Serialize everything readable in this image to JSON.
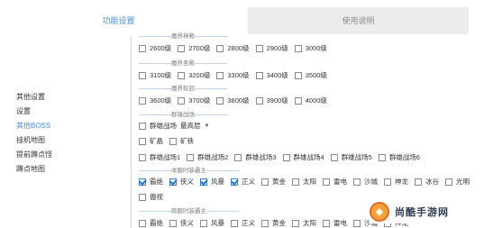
{
  "tabs": {
    "active": "功能设置",
    "inactive": "使用说明"
  },
  "sidebar": {
    "items": [
      {
        "label": "其他设置"
      },
      {
        "label": "设置"
      },
      {
        "label": "其他BOSS"
      },
      {
        "label": "挂机地图"
      },
      {
        "label": "提前蹲点怪"
      },
      {
        "label": "蹲点地图"
      }
    ],
    "active_index": 2
  },
  "sections": {
    "s1": {
      "title": "魔界神殿"
    },
    "s2": {
      "title": "魔界圣殿"
    },
    "s3": {
      "title": "魔界轮回"
    },
    "s4": {
      "title": "群雄战场"
    },
    "s5": {
      "title": "本服时装霸主"
    },
    "s6": {
      "title": "跨服时装霸主"
    }
  },
  "rows": {
    "r1": [
      {
        "label": "2600级",
        "checked": false
      },
      {
        "label": "2700级",
        "checked": false
      },
      {
        "label": "2800级",
        "checked": false
      },
      {
        "label": "2900级",
        "checked": false
      },
      {
        "label": "3000级",
        "checked": false
      }
    ],
    "r2": [
      {
        "label": "3100级",
        "checked": false
      },
      {
        "label": "3200级",
        "checked": false
      },
      {
        "label": "3300级",
        "checked": false
      },
      {
        "label": "3400级",
        "checked": false
      },
      {
        "label": "3500级",
        "checked": false
      }
    ],
    "r3": [
      {
        "label": "3600级",
        "checked": false
      },
      {
        "label": "3700级",
        "checked": false
      },
      {
        "label": "3800级",
        "checked": false
      },
      {
        "label": "3900级",
        "checked": false
      },
      {
        "label": "4000级",
        "checked": false
      }
    ],
    "r4": {
      "label": "群雄战场",
      "select_value": "最高层",
      "checked": false
    },
    "r5": [
      {
        "label": "矿晶",
        "checked": false
      },
      {
        "label": "矿铁",
        "checked": false
      }
    ],
    "r6": [
      {
        "label": "群雄战场1",
        "checked": false
      },
      {
        "label": "群雄战场2",
        "checked": false
      },
      {
        "label": "群雄战场3",
        "checked": false
      },
      {
        "label": "群雄战场4",
        "checked": false
      },
      {
        "label": "群雄战场5",
        "checked": false
      },
      {
        "label": "群雄战场6",
        "checked": false
      }
    ],
    "r7": [
      {
        "label": "霸绝",
        "checked": true
      },
      {
        "label": "侠义",
        "checked": true
      },
      {
        "label": "风暴",
        "checked": true
      },
      {
        "label": "正义",
        "checked": true
      },
      {
        "label": "黄金",
        "checked": false
      },
      {
        "label": "太阳",
        "checked": false
      },
      {
        "label": "雷电",
        "checked": false
      },
      {
        "label": "沙城",
        "checked": false
      },
      {
        "label": "神龙",
        "checked": false
      },
      {
        "label": "冰谷",
        "checked": false
      },
      {
        "label": "光明",
        "checked": false
      }
    ],
    "r8": [
      {
        "label": "傲视",
        "checked": false
      }
    ],
    "r9": [
      {
        "label": "霸绝",
        "checked": false
      },
      {
        "label": "侠义",
        "checked": false
      },
      {
        "label": "风暴",
        "checked": false
      },
      {
        "label": "正义",
        "checked": false
      },
      {
        "label": "黄金",
        "checked": false
      },
      {
        "label": "太阳",
        "checked": false
      },
      {
        "label": "雷电",
        "checked": false
      },
      {
        "label": "沙城",
        "checked": false
      },
      {
        "label": "神龙",
        "checked": false
      }
    ]
  },
  "watermark": {
    "text": "尚酷手游网"
  },
  "colors": {
    "accent": "#4a8fd6",
    "inactive_tab_bg": "#ececec"
  }
}
